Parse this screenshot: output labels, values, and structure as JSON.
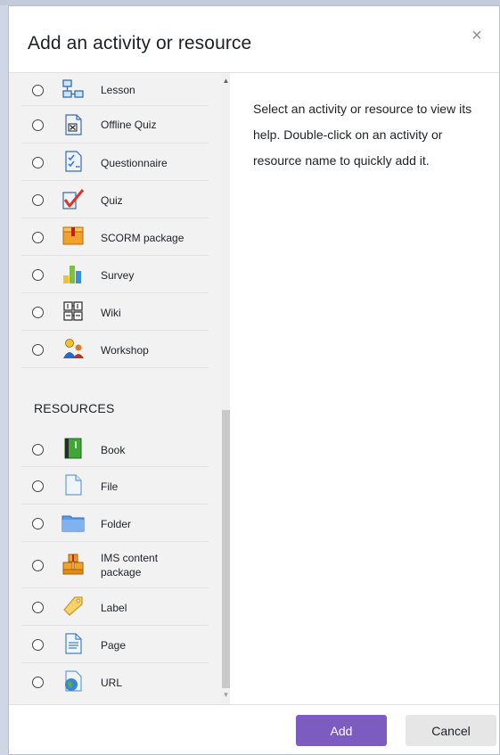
{
  "dialog": {
    "title": "Add an activity or resource",
    "close_glyph": "×"
  },
  "activities": [
    {
      "label": "Lesson",
      "icon": "lesson-icon"
    },
    {
      "label": "Offline Quiz",
      "icon": "offline-quiz-icon"
    },
    {
      "label": "Questionnaire",
      "icon": "questionnaire-icon"
    },
    {
      "label": "Quiz",
      "icon": "quiz-icon"
    },
    {
      "label": "SCORM package",
      "icon": "scorm-package-icon"
    },
    {
      "label": "Survey",
      "icon": "survey-icon"
    },
    {
      "label": "Wiki",
      "icon": "wiki-icon"
    },
    {
      "label": "Workshop",
      "icon": "workshop-icon"
    }
  ],
  "resources_heading": "RESOURCES",
  "resources": [
    {
      "label": "Book",
      "icon": "book-icon"
    },
    {
      "label": "File",
      "icon": "file-icon"
    },
    {
      "label": "Folder",
      "icon": "folder-icon"
    },
    {
      "label": "IMS content package",
      "icon": "ims-package-icon"
    },
    {
      "label": "Label",
      "icon": "label-tag-icon"
    },
    {
      "label": "Page",
      "icon": "page-icon"
    },
    {
      "label": "URL",
      "icon": "url-globe-icon"
    }
  ],
  "help": {
    "text": "Select an activity or resource to view its help. Double-click on an activity or resource name to quickly add it."
  },
  "footer": {
    "add_label": "Add",
    "cancel_label": "Cancel"
  },
  "colors": {
    "primary": "#7d5cc2",
    "panel_bg": "#f2f2f2"
  }
}
